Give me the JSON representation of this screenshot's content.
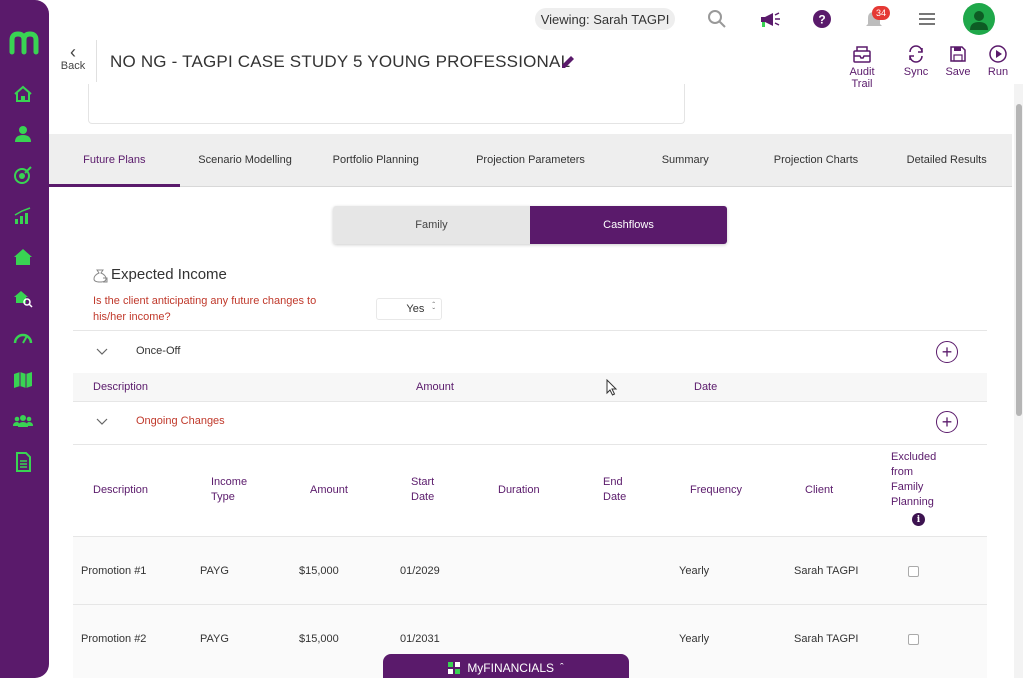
{
  "topbar": {
    "viewing": "Viewing: Sarah TAGPI",
    "notifications_count": "34"
  },
  "header": {
    "back_label": "Back",
    "title": "NO NG - TAGPI CASE STUDY 5 YOUNG PROFESSIONAL",
    "actions": [
      {
        "label": "Audit Trail",
        "icon": "audit-trail-icon"
      },
      {
        "label": "Sync",
        "icon": "sync-icon"
      },
      {
        "label": "Save",
        "icon": "save-icon"
      },
      {
        "label": "Run",
        "icon": "run-icon"
      }
    ]
  },
  "tabs": [
    {
      "label": "Future Plans",
      "active": true
    },
    {
      "label": "Scenario Modelling"
    },
    {
      "label": "Portfolio Planning"
    },
    {
      "label": "Projection Parameters"
    },
    {
      "label": "Summary"
    },
    {
      "label": "Projection Charts"
    },
    {
      "label": "Detailed Results"
    }
  ],
  "segment": {
    "family": "Family",
    "cashflows": "Cashflows",
    "selected": "Cashflows"
  },
  "income": {
    "title": "Expected Income",
    "question": "Is the client anticipating any future changes to his/her income?",
    "answer": "Yes"
  },
  "once_off": {
    "label": "Once-Off",
    "columns": [
      "Description",
      "Amount",
      "Date"
    ]
  },
  "ongoing": {
    "label": "Ongoing Changes",
    "columns": {
      "description": "Description",
      "income_type": "Income Type",
      "amount": "Amount",
      "start_date": "Start Date",
      "duration": "Duration",
      "end_date": "End Date",
      "frequency": "Frequency",
      "client": "Client",
      "excluded": "Excluded from Family Planning"
    },
    "rows": [
      {
        "description": "Promotion #1",
        "income_type": "PAYG",
        "amount": "$15,000",
        "start_date": "01/2029",
        "duration": "",
        "end_date": "",
        "frequency": "Yearly",
        "client": "Sarah TAGPI",
        "excluded": false
      },
      {
        "description": "Promotion #2",
        "income_type": "PAYG",
        "amount": "$15,000",
        "start_date": "01/2031",
        "duration": "",
        "end_date": "",
        "frequency": "Yearly",
        "client": "Sarah TAGPI",
        "excluded": false
      }
    ]
  },
  "footer": {
    "myfinancials": "MyFINANCIALS"
  },
  "colors": {
    "brand": "#5a1a6b",
    "sidebar_icons": "#39d353",
    "question_text": "#c0392b",
    "avatar": "#1fa84a"
  }
}
